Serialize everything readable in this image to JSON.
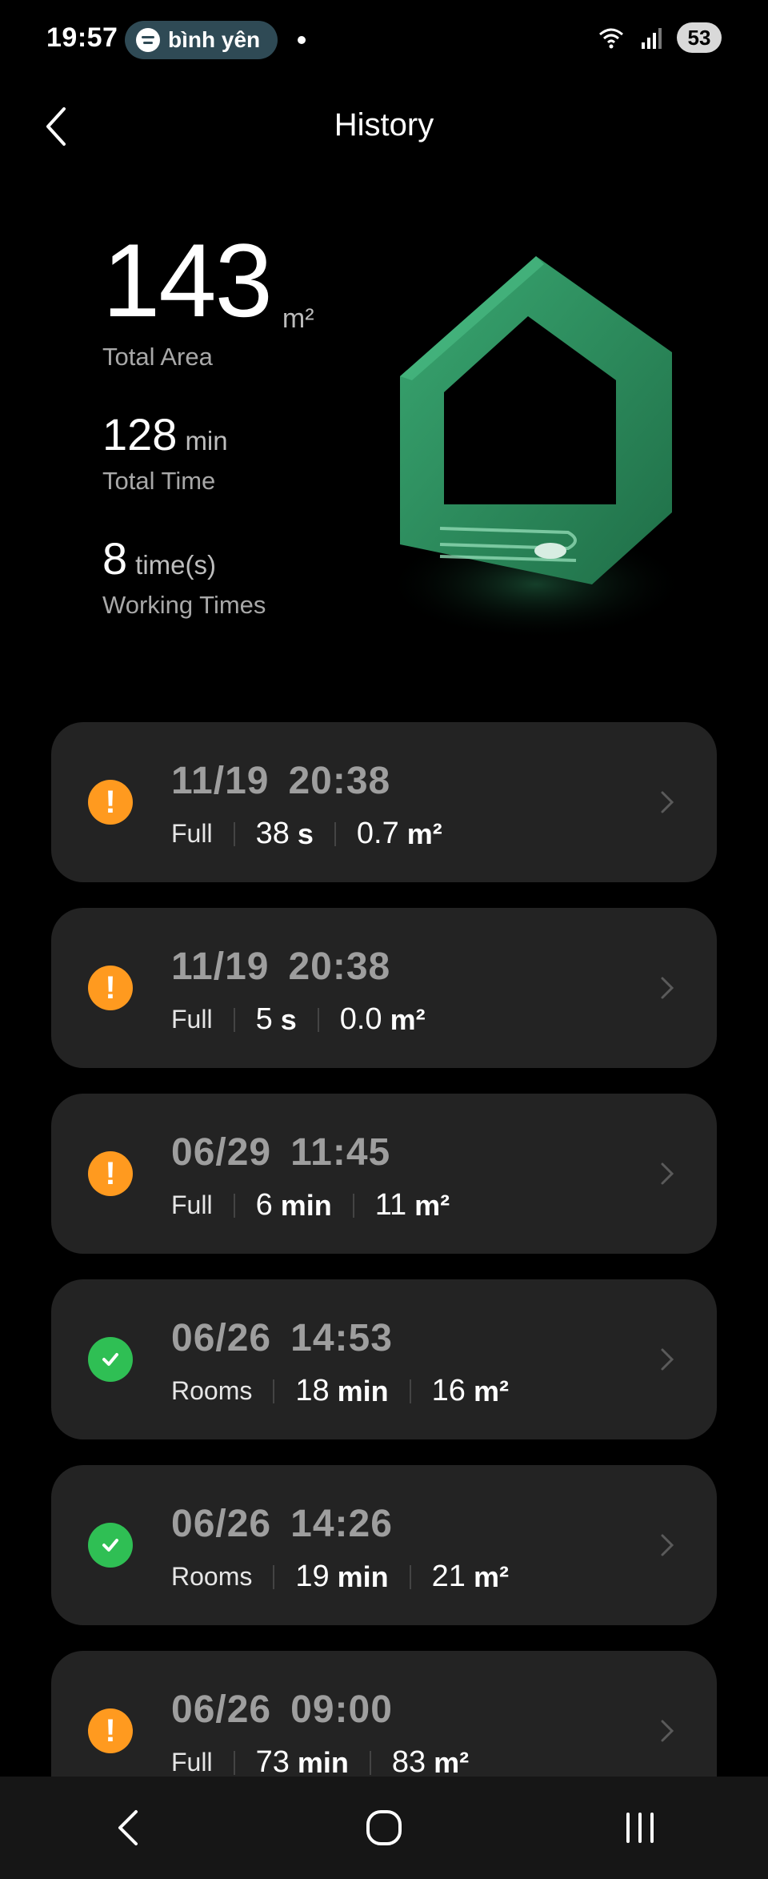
{
  "status_bar": {
    "time": "19:57",
    "media_label": "bình yên",
    "battery": "53"
  },
  "header": {
    "title": "History"
  },
  "stats": {
    "total_area_value": "143",
    "total_area_unit": "m²",
    "total_area_label": "Total Area",
    "total_time_value": "128",
    "total_time_unit": "min",
    "total_time_label": "Total Time",
    "working_times_value": "8",
    "working_times_unit": "time(s)",
    "working_times_label": "Working Times"
  },
  "history": [
    {
      "status": "warning",
      "date": "11/19",
      "time": "20:38",
      "mode": "Full",
      "duration": "38",
      "duration_unit": "s",
      "area": "0.7",
      "area_unit": "m²"
    },
    {
      "status": "warning",
      "date": "11/19",
      "time": "20:38",
      "mode": "Full",
      "duration": "5",
      "duration_unit": "s",
      "area": "0.0",
      "area_unit": "m²"
    },
    {
      "status": "warning",
      "date": "06/29",
      "time": "11:45",
      "mode": "Full",
      "duration": "6",
      "duration_unit": "min",
      "area": "11",
      "area_unit": "m²"
    },
    {
      "status": "success",
      "date": "06/26",
      "time": "14:53",
      "mode": "Rooms",
      "duration": "18",
      "duration_unit": "min",
      "area": "16",
      "area_unit": "m²"
    },
    {
      "status": "success",
      "date": "06/26",
      "time": "14:26",
      "mode": "Rooms",
      "duration": "19",
      "duration_unit": "min",
      "area": "21",
      "area_unit": "m²"
    },
    {
      "status": "warning",
      "date": "06/26",
      "time": "09:00",
      "mode": "Full",
      "duration": "73",
      "duration_unit": "min",
      "area": "83",
      "area_unit": "m²"
    }
  ],
  "colors": {
    "accent_warning": "#ff9a1f",
    "accent_success": "#2fbf54",
    "house_green": "#2e8a5c",
    "card_bg": "#232323"
  },
  "icons": {
    "back": "chevron-left-icon",
    "row_chevron": "chevron-right-icon",
    "warning": "exclamation-icon",
    "success": "check-icon"
  }
}
